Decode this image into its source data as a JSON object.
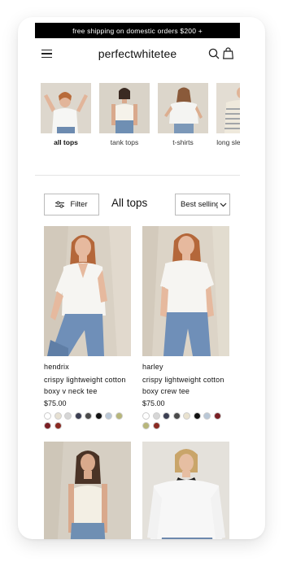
{
  "announcement": "free shipping on domestic orders $200 +",
  "brand": "perfectwhitetee",
  "icons": {
    "menu": "hamburger-menu-icon",
    "search": "search-icon",
    "bag": "shopping-bag-icon",
    "filter": "sliders-icon",
    "sort": "chevron-down-icon"
  },
  "categories": [
    {
      "label": "all tops",
      "active": true
    },
    {
      "label": "tank tops",
      "active": false
    },
    {
      "label": "t-shirts",
      "active": false
    },
    {
      "label": "long sleeve tops",
      "active": false
    }
  ],
  "toolbar": {
    "filter_label": "Filter",
    "heading": "All tops",
    "sort_label": "Best selling"
  },
  "products": [
    {
      "name": "hendrix",
      "desc": "crispy lightweight cotton boxy v neck tee",
      "price": "$75.00",
      "swatches": [
        "#ffffff",
        "#e6e0d2",
        "#d6d6d6",
        "#3b3e52",
        "#4a4a4a",
        "#111111",
        "#b9c7d6",
        "#b7b67a",
        "#7a1f24",
        "#8a2a22"
      ]
    },
    {
      "name": "harley",
      "desc": "crispy lightweight cotton boxy crew tee",
      "price": "$75.00",
      "swatches": [
        "#ffffff",
        "#d6d6d6",
        "#3b3e52",
        "#4a4a4a",
        "#e9e2cf",
        "#111111",
        "#b9c7d6",
        "#7a1f24",
        "#b7b67a",
        "#8a2a22"
      ]
    }
  ],
  "colors": {
    "announcement_bg": "#000000",
    "text": "#111111",
    "border": "#bbbbbb"
  }
}
